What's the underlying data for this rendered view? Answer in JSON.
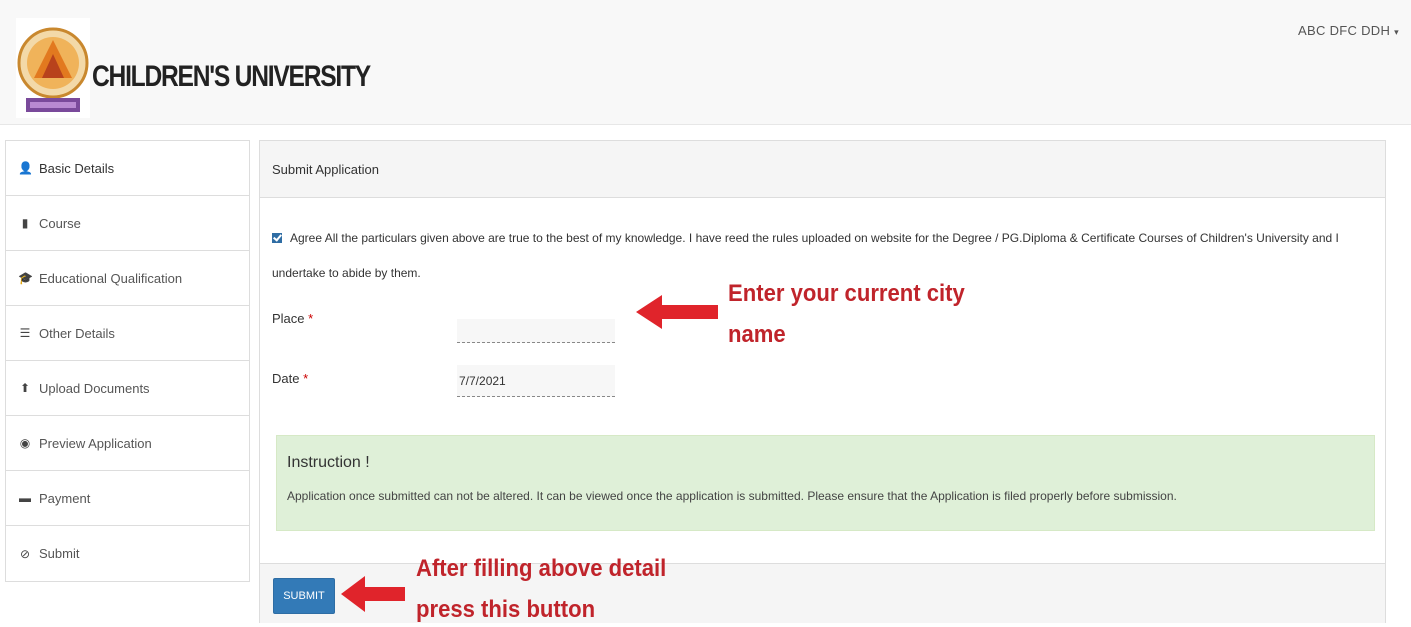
{
  "header": {
    "brand": "CHILDREN'S UNIVERSITY",
    "user_name": "ABC DFC DDH",
    "user_caret": "▾"
  },
  "sidebar": {
    "items": [
      {
        "label": "Basic Details",
        "icon": "user-icon",
        "glyph": "👤"
      },
      {
        "label": "Course",
        "icon": "book-icon",
        "glyph": "▮"
      },
      {
        "label": "Educational Qualification",
        "icon": "graduation-cap-icon",
        "glyph": "🎓"
      },
      {
        "label": "Other Details",
        "icon": "list-icon",
        "glyph": "☰"
      },
      {
        "label": "Upload Documents",
        "icon": "upload-icon",
        "glyph": "⬆"
      },
      {
        "label": "Preview Application",
        "icon": "eye-icon",
        "glyph": "◉"
      },
      {
        "label": "Payment",
        "icon": "credit-card-icon",
        "glyph": "▬"
      },
      {
        "label": "Submit",
        "icon": "check-circle-icon",
        "glyph": "⊘"
      }
    ]
  },
  "main": {
    "panel_title": "Submit Application",
    "agree_text": "Agree All the particulars given above are true to the best of my knowledge. I have reed the rules uploaded on website for the Degree / PG.Diploma & Certificate Courses of Children's University and I undertake to abide by them.",
    "agree_checked": true,
    "place": {
      "label": "Place",
      "required": "*",
      "value": ""
    },
    "date": {
      "label": "Date",
      "required": "*",
      "value": "7/7/2021"
    },
    "instruction": {
      "title": "Instruction !",
      "text": "Application once submitted can not be altered. It can be viewed once the application is submitted. Please ensure that the Application is filed properly before submission."
    },
    "submit_label": "SUBMIT"
  },
  "annotations": {
    "city_note_line1": "Enter your current city",
    "city_note_line2": "name",
    "submit_note_line1": "After filling above detail",
    "submit_note_line2": "press this button"
  },
  "colors": {
    "accent": "#337ab7",
    "annotation": "#c0242b",
    "instruction_bg": "#dff0d8"
  }
}
